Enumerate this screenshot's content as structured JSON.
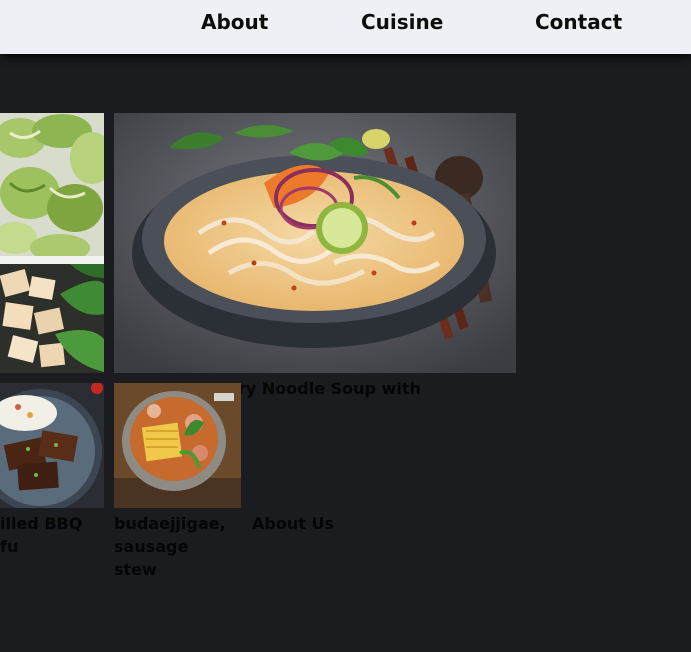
{
  "nav": {
    "about": "About",
    "cuisine": "Cuisine",
    "contact": "Contact"
  },
  "dishes": {
    "curry_noodle_caption": "ry Noodle Soup with",
    "bbq_caption_line1": "illed BBQ",
    "bbq_caption_line2": "fu",
    "stew_caption_line1": "budaejjigae,",
    "stew_caption_line2": "sausage",
    "stew_caption_line3": "stew",
    "about_us_link": "About Us"
  },
  "colors": {
    "page_background": "#1b1c20",
    "topbar_background": "#eef0f5",
    "text": "#050505"
  }
}
